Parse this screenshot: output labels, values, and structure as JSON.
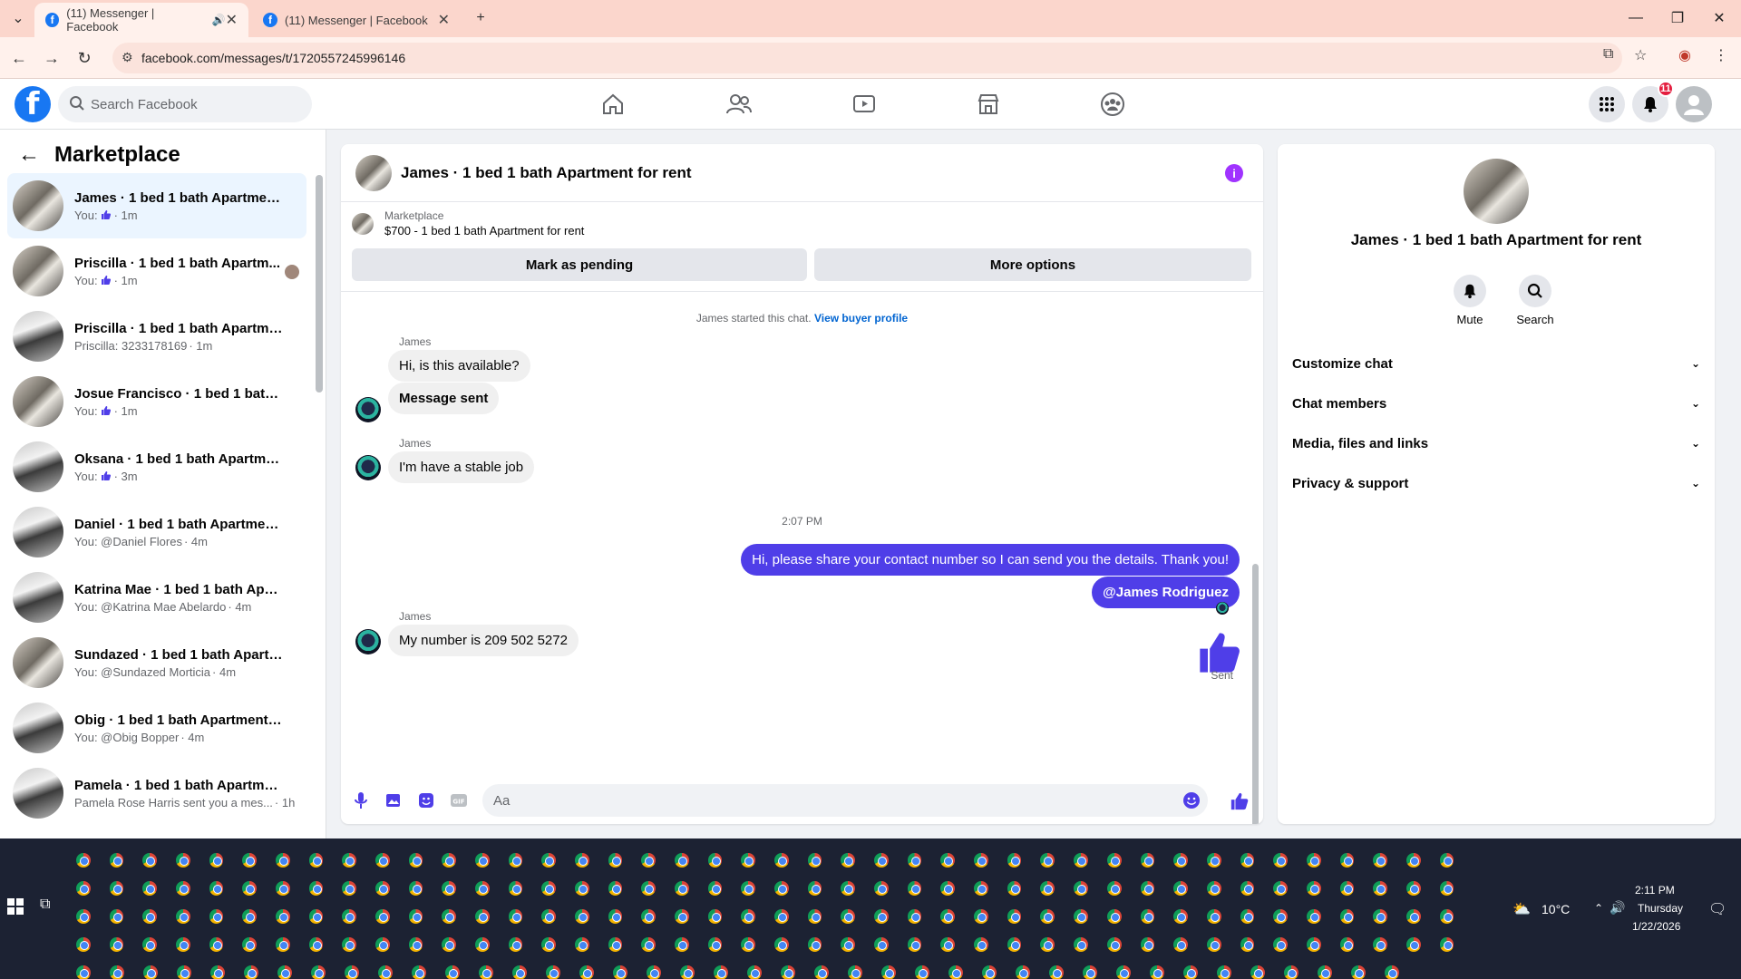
{
  "browser": {
    "tabs": [
      {
        "title": "(11) Messenger | Facebook",
        "active": true
      },
      {
        "title": "(11) Messenger | Facebook",
        "active": false
      }
    ],
    "url": "facebook.com/messages/t/1720557245996146"
  },
  "fb": {
    "search_placeholder": "Search Facebook",
    "notification_count": "11"
  },
  "sidebar": {
    "title": "Marketplace",
    "conversations": [
      {
        "name": "James · 1 bed 1 bath Apartment ...",
        "prefix": "You:",
        "thumb": true,
        "time": "· 1m",
        "active": true
      },
      {
        "name": "Priscilla · 1 bed 1 bath Apartm...",
        "prefix": "You:",
        "thumb": true,
        "time": "· 1m",
        "seen": true
      },
      {
        "name": "Priscilla · 1 bed 1 bath Apartmen...",
        "prefix": "Priscilla: 3233178169",
        "thumb": false,
        "time": "· 1m"
      },
      {
        "name": "Josue Francisco · 1 bed 1 bath A...",
        "prefix": "You:",
        "thumb": true,
        "time": "· 1m"
      },
      {
        "name": "Oksana · 1 bed 1 bath Apartmen...",
        "prefix": "You:",
        "thumb": true,
        "time": "· 3m"
      },
      {
        "name": "Daniel · 1 bed 1 bath Apartment ...",
        "prefix": "You: @Daniel Flores",
        "thumb": false,
        "time": "· 4m"
      },
      {
        "name": "Katrina Mae · 1 bed 1 bath Apart...",
        "prefix": "You: @Katrina Mae Abelardo",
        "thumb": false,
        "time": "· 4m"
      },
      {
        "name": "Sundazed · 1 bed 1 bath Apartm...",
        "prefix": "You: @Sundazed Morticia",
        "thumb": false,
        "time": "· 4m"
      },
      {
        "name": "Obig · 1 bed 1 bath Apartment f...",
        "prefix": "You: @Obig Bopper",
        "thumb": false,
        "time": "· 4m"
      },
      {
        "name": "Pamela · 1 bed 1 bath Apartment...",
        "prefix": "Pamela Rose Harris sent you a mes...",
        "thumb": false,
        "time": "· 1h"
      }
    ]
  },
  "chat": {
    "title": "James · 1 bed 1 bath Apartment for rent",
    "listing_source": "Marketplace",
    "listing_title": "$700 - 1 bed 1 bath Apartment for rent",
    "mark_pending": "Mark as pending",
    "more_options": "More options",
    "started_text": "James started this chat.",
    "view_profile": "View buyer profile",
    "sender_name": "James",
    "msg1": "Hi, is this available?",
    "msg2": "Message sent",
    "msg3": "I'm have a stable job",
    "timestamp": "2:07 PM",
    "out1": "Hi, please share your contact number so I can send you the details. Thank you!",
    "out2": "@James Rodriguez",
    "msg4": "My number is 209 502 5272",
    "sent_label": "Sent",
    "composer_placeholder": "Aa"
  },
  "details": {
    "name": "James · 1 bed 1 bath Apartment for rent",
    "mute": "Mute",
    "search": "Search",
    "sections": [
      "Customize chat",
      "Chat members",
      "Media, files and links",
      "Privacy & support"
    ]
  },
  "taskbar": {
    "temperature": "10°C",
    "time": "2:11 PM",
    "day": "Thursday",
    "date": "1/22/2026"
  },
  "colors": {
    "accent": "#4f3ee8",
    "fb_blue": "#1877f2",
    "tab_strip": "#fbd6cc"
  }
}
